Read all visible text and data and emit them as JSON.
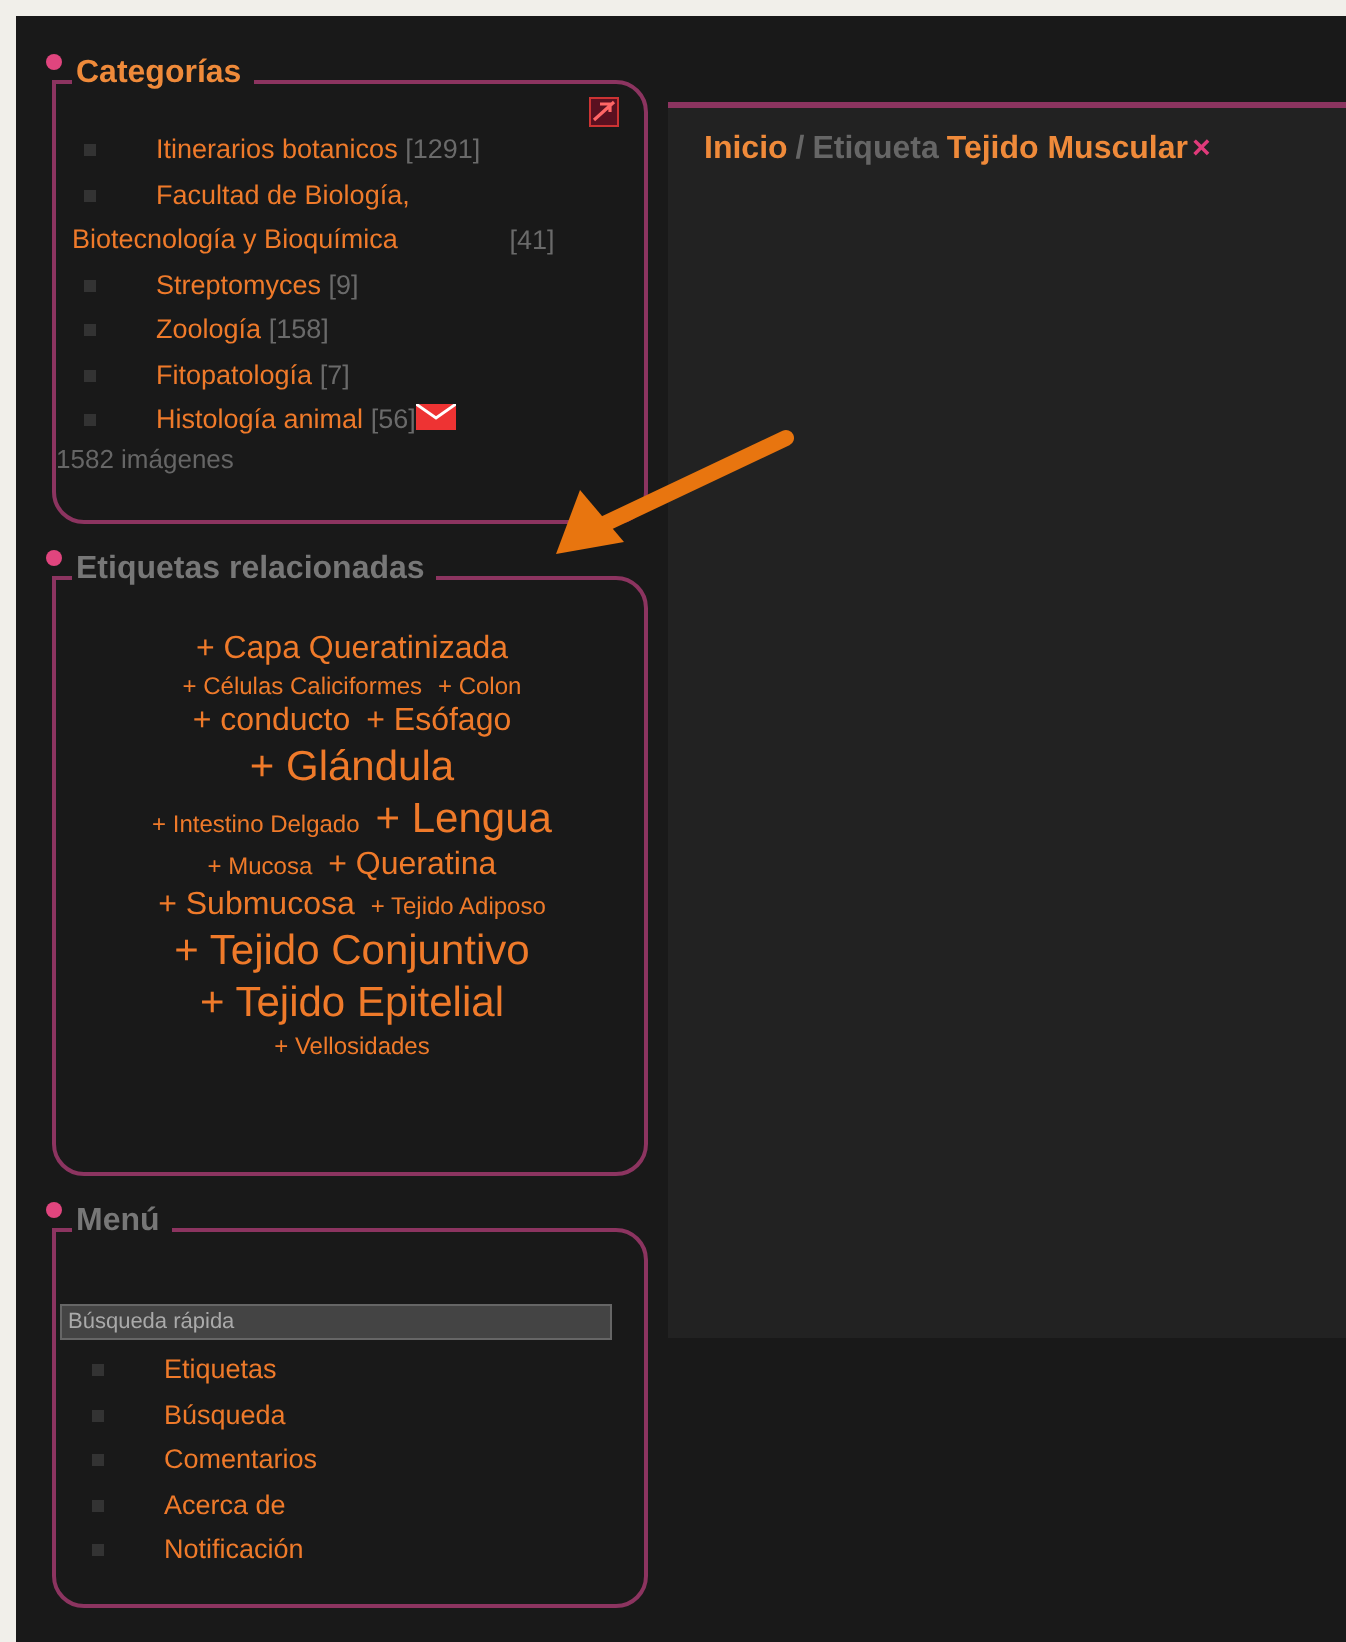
{
  "categories": {
    "title": "Categorías",
    "highlighted": true,
    "items": [
      {
        "name": "Itinerarios botanicos",
        "count": "[1291]",
        "notify": false
      },
      {
        "name": "Facultad de Biología, Biotecnología y Bioquímica",
        "count": "[41]",
        "notify": false
      },
      {
        "name": "Streptomyces",
        "count": "[9]",
        "notify": false
      },
      {
        "name": "Zoología",
        "count": "[158]",
        "notify": false
      },
      {
        "name": "Fitopatología",
        "count": "[7]",
        "notify": false
      },
      {
        "name": "Histología animal",
        "count": "[56]",
        "notify": true
      }
    ],
    "footer": "1582 imágenes"
  },
  "related_tags": {
    "title": "Etiquetas relacionadas",
    "highlighted": false,
    "lines": [
      [
        {
          "label": "+ Capa Queratinizada",
          "kind": "medium"
        }
      ],
      [
        {
          "label": "+ Células Caliciformes",
          "kind": "small"
        },
        {
          "label": "+ Colon",
          "kind": "small"
        }
      ],
      [
        {
          "label": "+ conducto",
          "kind": "medium"
        },
        {
          "label": "+ Esófago",
          "kind": "medium"
        }
      ],
      [
        {
          "label": "+ Glándula",
          "kind": "large"
        }
      ],
      [
        {
          "label": "+ Intestino Delgado",
          "kind": "small"
        },
        {
          "label": "+ Lengua",
          "kind": "large"
        }
      ],
      [
        {
          "label": "+ Mucosa",
          "kind": "small"
        },
        {
          "label": "+ Queratina",
          "kind": "medium"
        }
      ],
      [
        {
          "label": "+ Submucosa",
          "kind": "medium"
        },
        {
          "label": "+ Tejido Adiposo",
          "kind": "small"
        }
      ],
      [
        {
          "label": "+ Tejido Conjuntivo",
          "kind": "large"
        }
      ],
      [
        {
          "label": "+ Tejido Epitelial",
          "kind": "large"
        }
      ],
      [
        {
          "label": "+ Vellosidades",
          "kind": "small"
        }
      ]
    ]
  },
  "menu": {
    "title": "Menú",
    "highlighted": false,
    "search": {
      "placeholder": "Búsqueda rápida"
    },
    "items": [
      "Etiquetas",
      "Búsqueda",
      "Comentarios",
      "Acerca de",
      "Notificación"
    ]
  },
  "breadcrumb": {
    "home": "Inicio",
    "separator": "/",
    "section": "Etiqueta",
    "tag": "Tejido Muscular",
    "remove": "×"
  }
}
